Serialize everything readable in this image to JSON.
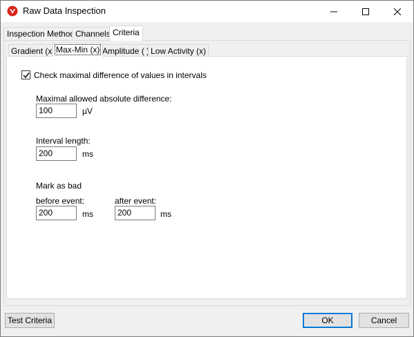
{
  "window": {
    "title": "Raw Data Inspection"
  },
  "main_tabs": [
    {
      "label": "Inspection Method"
    },
    {
      "label": "Channels"
    },
    {
      "label": "Criteria"
    }
  ],
  "criteria_tabs": [
    {
      "label": "Gradient (x)"
    },
    {
      "label": "Max-Min (x)"
    },
    {
      "label": "Amplitude ( )"
    },
    {
      "label": "Low Activity (x)"
    }
  ],
  "maxmin": {
    "check_label": "Check maximal difference of values in intervals",
    "checked": true,
    "max_diff_label": "Maximal allowed absolute difference:",
    "max_diff_value": "100",
    "max_diff_unit": "µV",
    "interval_label": "Interval length:",
    "interval_value": "200",
    "interval_unit": "ms",
    "mark_bad_label": "Mark as bad",
    "before_label": "before event:",
    "before_value": "200",
    "before_unit": "ms",
    "after_label": "after event:",
    "after_value": "200",
    "after_unit": "ms"
  },
  "buttons": {
    "test_criteria": "Test Criteria",
    "ok": "OK",
    "cancel": "Cancel"
  },
  "colors": {
    "accent": "#0078d7",
    "icon_red": "#d9261c"
  }
}
